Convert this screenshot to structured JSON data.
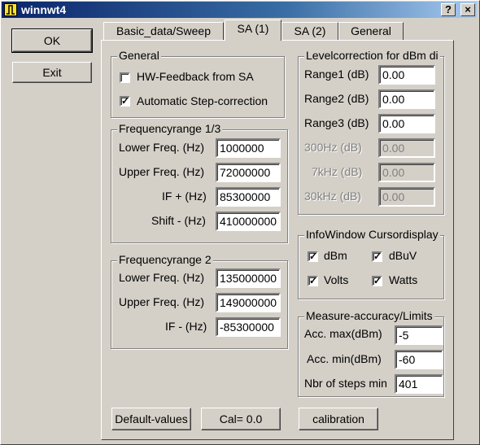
{
  "window": {
    "title": "winnwt4",
    "help_btn": "?",
    "close_btn": "×"
  },
  "side": {
    "ok": "OK",
    "exit": "Exit"
  },
  "tabs": [
    {
      "label": "Basic_data/Sweep"
    },
    {
      "label": "SA (1)"
    },
    {
      "label": "SA (2)"
    },
    {
      "label": "General"
    }
  ],
  "general": {
    "title": "General",
    "hw_feedback": {
      "label": "HW-Feedback from SA",
      "checked": false
    },
    "auto_step": {
      "label": "Automatic Step-correction",
      "checked": true
    }
  },
  "range1": {
    "title": "Frequencyrange 1/3",
    "lower_label": "Lower Freq. (Hz)",
    "lower": "1000000",
    "upper_label": "Upper Freq. (Hz)",
    "upper": "72000000",
    "if_label": "IF + (Hz)",
    "if": "85300000",
    "shift_label": "Shift - (Hz)",
    "shift": "410000000"
  },
  "range2": {
    "title": "Frequencyrange 2",
    "lower_label": "Lower Freq. (Hz)",
    "lower": "135000000",
    "upper_label": "Upper Freq. (Hz)",
    "upper": "149000000",
    "if_label": "IF - (Hz)",
    "if": "-85300000"
  },
  "level": {
    "title": "Levelcorrection for dBm di",
    "r1_label": "Range1 (dB)",
    "r1": "0.00",
    "r2_label": "Range2 (dB)",
    "r2": "0.00",
    "r3_label": "Range3 (dB)",
    "r3": "0.00",
    "f300_label": "300Hz (dB)",
    "f300": "0.00",
    "f7k_label": "7kHz (dB)",
    "f7k": "0.00",
    "f30k_label": "30kHz (dB)",
    "f30k": "0.00"
  },
  "info": {
    "title": "InfoWindow Cursordisplay",
    "dbm": "dBm",
    "dbuv": "dBuV",
    "volts": "Volts",
    "watts": "Watts"
  },
  "accuracy": {
    "title": "Measure-accuracy/Limits",
    "max_label": "Acc. max(dBm)",
    "max": "-5",
    "min_label": "Acc. min(dBm)",
    "min": "-60",
    "steps_label": "Nbr of steps min",
    "steps": "401"
  },
  "bottom": {
    "defaults": "Default-values",
    "cal": "Cal= 0.0",
    "calibration": "calibration"
  }
}
